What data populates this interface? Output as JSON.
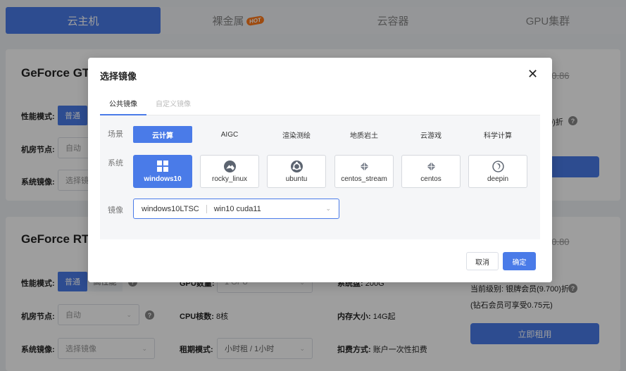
{
  "top_tabs": [
    {
      "label": "云主机"
    },
    {
      "label": "裸金属",
      "badge": "HOT"
    },
    {
      "label": "云容器"
    },
    {
      "label": "GPU集群"
    }
  ],
  "card1": {
    "title": "GeForce GT",
    "old_price": "¥0.86",
    "perf_label": "性能模式:",
    "perf_value": "普通",
    "node_label": "机房节点:",
    "node_value": "自动",
    "image_label": "系统镜像:",
    "image_placeholder": "选择镜",
    "discount_text": "0)折"
  },
  "card2": {
    "title": "GeForce RT",
    "old_price": "¥0.80",
    "perf_label": "性能模式:",
    "perf_normal": "普通",
    "perf_high": "高性能",
    "gpu_label": "GPU数量:",
    "gpu_value": "1 GPU",
    "disk_label": "系统盘:",
    "disk_value": "200G",
    "node_label": "机房节点:",
    "node_value": "自动",
    "cpu_label": "CPU核数:",
    "cpu_value": "8核",
    "mem_label": "内存大小:",
    "mem_value": "14G起",
    "image_label": "系统镜像:",
    "image_placeholder": "选择镜像",
    "rent_label": "租期模式:",
    "rent_value": "小时租 / 1小时",
    "deduct_label": "扣费方式:",
    "deduct_value": "账户一次性扣费",
    "level_text": "当前级别: 银牌会员(9.700)折",
    "diamond_text": "(钻石会员可享受0.75元)",
    "rent_button": "立即租用"
  },
  "modal": {
    "title": "选择镜像",
    "tabs": [
      {
        "label": "公共镜像",
        "active": true
      },
      {
        "label": "自定义镜像",
        "active": false
      }
    ],
    "scene_label": "场景",
    "scenes": [
      "云计算",
      "AIGC",
      "渲染测绘",
      "地质岩土",
      "云游戏",
      "科学计算"
    ],
    "system_label": "系统",
    "systems": [
      {
        "label": "windows10",
        "icon": "windows-icon"
      },
      {
        "label": "rocky_linux",
        "icon": "rocky-icon"
      },
      {
        "label": "ubuntu",
        "icon": "ubuntu-icon"
      },
      {
        "label": "centos_stream",
        "icon": "centos-icon"
      },
      {
        "label": "centos",
        "icon": "centos-icon"
      },
      {
        "label": "deepin",
        "icon": "deepin-icon"
      }
    ],
    "image_label": "镜像",
    "image_value_1": "windows10LTSC",
    "image_value_2": "win10 cuda11",
    "cancel": "取消",
    "confirm": "确定"
  },
  "colors": {
    "accent": "#4a7be8",
    "hot": "#ff7a1a"
  }
}
